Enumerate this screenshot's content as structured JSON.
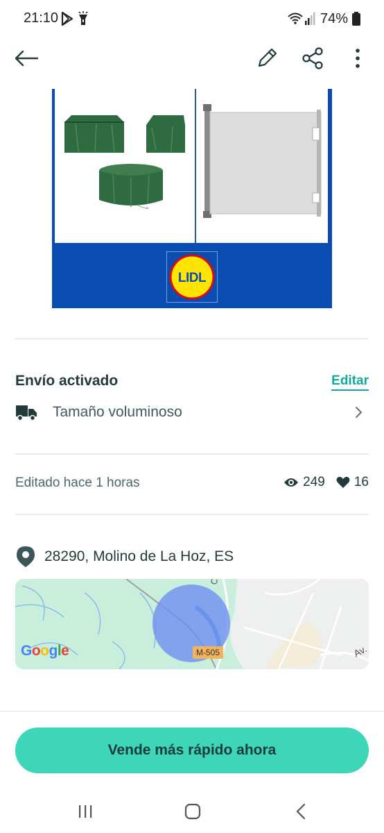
{
  "status_bar": {
    "time": "21:10",
    "battery": "74%",
    "icons": [
      "play-store-icon",
      "flashlight-icon",
      "wifi-icon",
      "signal-icon",
      "battery-icon"
    ]
  },
  "app_bar": {
    "icons": [
      "back-arrow-icon",
      "pencil-icon",
      "share-icon",
      "more-vert-icon"
    ]
  },
  "product_image": {
    "brand_logo_text": "LIDL"
  },
  "shipping": {
    "title": "Envío activado",
    "edit_label": "Editar",
    "size_label": "Tamaño voluminoso"
  },
  "stats": {
    "edited": "Editado hace 1 horas",
    "views": "249",
    "favorites": "16"
  },
  "location": {
    "address": "28290, Molino de La Hoz, ES",
    "map_google": "Google",
    "map_road": "M-505",
    "map_street_1": "C. Ca",
    "map_street_2": "Av."
  },
  "cta": {
    "label": "Vende más rápido ahora"
  },
  "colors": {
    "accent": "#13a89e",
    "cta_bg": "#3dd6b9",
    "lidl_blue": "#0a4db0",
    "lidl_yellow": "#ffe500",
    "lidl_red": "#e30613"
  }
}
